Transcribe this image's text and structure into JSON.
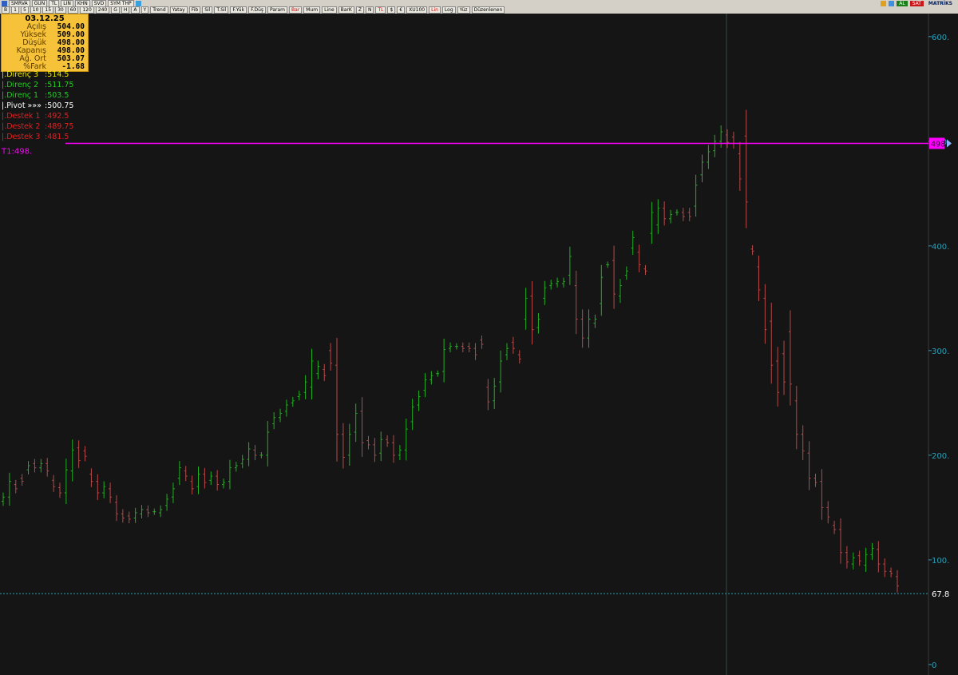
{
  "toolbar": {
    "symbol": "SMRVA",
    "row1": [
      "GUN",
      "TL",
      "LIN",
      "KHN",
      "SVD",
      "SYM THP"
    ],
    "row2": [
      "B",
      "1",
      "5",
      "10",
      "15",
      "30",
      "60",
      "120",
      "240",
      "G",
      "H",
      "A",
      "Y",
      "Trend",
      "Yatay",
      "Fib",
      "Sil",
      "T.Sil",
      "F.Yük",
      "F.Düş",
      "Param",
      "Bar",
      "Mum",
      "Line",
      "BarK",
      "Z",
      "N",
      "TL",
      "$",
      "€",
      "XU100",
      "Lin",
      "Log",
      "Yüz",
      "Düzenlenen"
    ],
    "right": {
      "al": "AL",
      "sat": "SAT",
      "brand": "MATRİKS"
    }
  },
  "info": {
    "date": "03.12.25",
    "rows": [
      {
        "label": "Açılış",
        "value": "504.00"
      },
      {
        "label": "Yüksek",
        "value": "509.00"
      },
      {
        "label": "Düşük",
        "value": "498.00"
      },
      {
        "label": "Kapanış",
        "value": "498.00"
      },
      {
        "label": "Ağ. Ort",
        "value": "503.07"
      },
      {
        "label": "%Fark",
        "value": "-1.68"
      }
    ]
  },
  "pivots": [
    {
      "label": "|.Direnç 3",
      "value": ":514.5",
      "color": "#e6e600"
    },
    {
      "label": "|.Direnç 2",
      "value": ":511.75",
      "color": "#22cc22"
    },
    {
      "label": "|.Direnç 1",
      "value": ":503.5",
      "color": "#22cc22"
    },
    {
      "label": "|.Pivot  »»»",
      "value": ":500.75",
      "color": "#ffffff"
    },
    {
      "label": "|.Destek 1",
      "value": ":492.5",
      "color": "#e02020"
    },
    {
      "label": "|.Destek 2",
      "value": ":489.75",
      "color": "#e02020"
    },
    {
      "label": "|.Destek 3",
      "value": ":481.5",
      "color": "#e02020"
    }
  ],
  "t1_label": "T1:498.",
  "chart_data": {
    "type": "ohlc",
    "ylim": [
      -10,
      622
    ],
    "yticks": [
      0,
      100,
      200,
      300,
      400,
      500,
      600
    ],
    "ytick_labels": [
      "0",
      "100.",
      "200.",
      "300.",
      "400.",
      "500.",
      "600."
    ],
    "hline": {
      "value": 498,
      "label": "498",
      "color": "#ff00ff"
    },
    "last": {
      "value": 67.8,
      "label": "67.8",
      "color": "#2bb5b5"
    },
    "colors": {
      "up": "#20b020",
      "down": "#b84848",
      "axis": "#2aa0b8"
    },
    "series": [
      {
        "name": "",
        "points": [
          [
            156,
            160
          ],
          [
            160,
            175
          ],
          [
            172,
            168
          ],
          [
            178,
            175
          ],
          [
            186,
            190
          ],
          [
            192,
            188
          ],
          [
            188,
            192
          ],
          [
            192,
            185
          ],
          [
            176,
            170
          ],
          [
            169,
            164
          ],
          [
            164,
            186
          ],
          [
            185,
            205
          ],
          [
            207,
            195
          ],
          [
            204,
            199
          ],
          [
            182,
            175
          ],
          [
            175,
            164
          ],
          [
            164,
            170
          ],
          [
            168,
            160
          ],
          [
            155,
            144
          ],
          [
            144,
            140
          ],
          [
            142,
            139
          ],
          [
            140,
            145
          ],
          [
            144,
            148
          ],
          [
            148,
            145
          ],
          [
            146,
            146
          ],
          [
            145,
            148
          ],
          [
            152,
            158
          ],
          [
            160,
            168
          ],
          [
            178,
            188
          ],
          [
            185,
            180
          ],
          [
            175,
            168
          ],
          [
            170,
            182
          ],
          [
            182,
            174
          ],
          [
            176,
            180
          ],
          [
            180,
            172
          ],
          [
            172,
            174
          ],
          [
            175,
            188
          ],
          [
            188,
            190
          ],
          [
            192,
            196
          ],
          [
            196,
            206
          ],
          [
            205,
            200
          ],
          [
            200,
            200
          ],
          [
            200,
            222
          ],
          [
            230,
            236
          ],
          [
            236,
            240
          ],
          [
            242,
            248
          ],
          [
            250,
            252
          ],
          [
            256,
            258
          ],
          [
            260,
            270
          ],
          [
            265,
            290
          ],
          [
            278,
            285
          ],
          [
            282,
            276
          ],
          [
            300,
            288
          ],
          [
            286,
            220
          ],
          [
            220,
            198
          ],
          [
            200,
            220
          ],
          [
            222,
            240
          ],
          [
            242,
            212
          ],
          [
            214,
            210
          ],
          [
            210,
            200
          ],
          [
            202,
            215
          ],
          [
            215,
            212
          ],
          [
            212,
            200
          ],
          [
            200,
            205
          ],
          [
            205,
            225
          ],
          [
            232,
            246
          ],
          [
            248,
            256
          ],
          [
            262,
            272
          ],
          [
            272,
            276
          ],
          [
            278,
            278
          ],
          [
            280,
            301
          ],
          [
            302,
            304
          ],
          [
            304,
            304
          ],
          [
            304,
            302
          ],
          [
            304,
            302
          ],
          [
            302,
            296
          ],
          [
            310,
            306
          ],
          [
            265,
            251
          ],
          [
            252,
            266
          ],
          [
            270,
            290
          ],
          [
            296,
            302
          ],
          [
            308,
            302
          ],
          [
            296,
            292
          ],
          [
            330,
            350
          ],
          [
            352,
            320
          ],
          [
            322,
            330
          ],
          [
            350,
            360
          ],
          [
            362,
            364
          ],
          [
            364,
            366
          ],
          [
            364,
            366
          ],
          [
            372,
            390
          ],
          [
            362,
            330
          ],
          [
            330,
            312
          ],
          [
            312,
            330
          ],
          [
            326,
            330
          ],
          [
            345,
            370
          ],
          [
            382,
            382
          ],
          [
            386,
            354
          ],
          [
            352,
            362
          ],
          [
            372,
            376
          ],
          [
            398,
            408
          ],
          [
            394,
            382
          ],
          [
            378,
            376
          ],
          [
            412,
            432
          ],
          [
            420,
            436
          ],
          [
            436,
            426
          ],
          [
            426,
            430
          ],
          [
            432,
            432
          ],
          [
            432,
            428
          ],
          [
            432,
            428
          ],
          [
            438,
            458
          ],
          [
            468,
            480
          ],
          [
            480,
            490
          ],
          [
            491,
            500
          ],
          [
            500,
            509
          ],
          [
            506,
            499
          ],
          [
            504,
            498
          ],
          [
            488,
            464
          ],
          [
            505,
            442
          ],
          [
            397,
            395
          ],
          [
            380,
            358
          ],
          [
            350,
            320
          ],
          [
            328,
            286
          ],
          [
            290,
            260
          ],
          [
            297,
            270
          ],
          [
            318,
            268
          ],
          [
            252,
            220
          ],
          [
            220,
            204
          ],
          [
            202,
            178
          ],
          [
            178,
            174
          ],
          [
            175,
            150
          ],
          [
            150,
            141
          ],
          [
            133,
            129
          ],
          [
            129,
            107
          ],
          [
            107,
            98
          ],
          [
            96,
            102
          ],
          [
            104,
            99
          ],
          [
            95,
            105
          ],
          [
            105,
            111
          ],
          [
            110,
            96
          ],
          [
            96,
            89
          ],
          [
            89,
            87
          ],
          [
            84,
            75
          ]
        ]
      }
    ]
  }
}
